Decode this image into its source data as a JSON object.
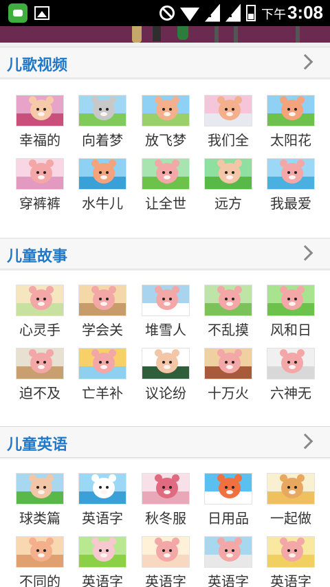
{
  "status_bar": {
    "time_prefix": "下午",
    "time": "3:08",
    "app_icon": "app-notification-icon",
    "picture_icon": "image-icon",
    "icons_right": [
      "blocked-icon",
      "wifi-icon",
      "signal-icon",
      "signal-icon",
      "battery-icon"
    ]
  },
  "colors": {
    "section_title": "#1f78c8",
    "banner": "#6b2a4f",
    "statusbar": "#000000"
  },
  "sections": [
    {
      "title": "儿歌视频",
      "items": [
        {
          "label": "幸福的",
          "thumb": "girl-stage"
        },
        {
          "label": "向着梦",
          "thumb": "animals-field"
        },
        {
          "label": "放飞梦",
          "thumb": "bear-sky"
        },
        {
          "label": "我们全",
          "thumb": "animal-group"
        },
        {
          "label": "太阳花",
          "thumb": "bears-green"
        },
        {
          "label": "穿裤裤",
          "thumb": "bear-pink-room"
        },
        {
          "label": "水牛儿",
          "thumb": "bears-water"
        },
        {
          "label": "让全世",
          "thumb": "bears-meadow"
        },
        {
          "label": "远方",
          "thumb": "girls-red"
        },
        {
          "label": "我最爱",
          "thumb": "swan-boat"
        }
      ]
    },
    {
      "title": "儿童故事",
      "items": [
        {
          "label": "心灵手",
          "thumb": "bear-flower"
        },
        {
          "label": "学会关",
          "thumb": "bears-room"
        },
        {
          "label": "堆雪人",
          "thumb": "snow-rabbit"
        },
        {
          "label": "不乱摸",
          "thumb": "bear-forest"
        },
        {
          "label": "风和日",
          "thumb": "bears-sunny"
        },
        {
          "label": "迫不及",
          "thumb": "bears-classroom"
        },
        {
          "label": "亡羊补",
          "thumb": "bear-rainbow"
        },
        {
          "label": "议论纷",
          "thumb": "blackboard"
        },
        {
          "label": "十万火",
          "thumb": "bear-library"
        },
        {
          "label": "六神无",
          "thumb": "bears-white"
        }
      ]
    },
    {
      "title": "儿童英语",
      "items": [
        {
          "label": "球类篇",
          "thumb": "boy-soccer"
        },
        {
          "label": "英语字",
          "thumb": "goose-lake"
        },
        {
          "label": "秋冬服",
          "thumb": "scarf"
        },
        {
          "label": "日用品",
          "thumb": "umbrella"
        },
        {
          "label": "一起做",
          "thumb": "flour-bag"
        },
        {
          "label": "不同的",
          "thumb": "girl-brown"
        },
        {
          "label": "英语字",
          "thumb": "rabbit-green"
        },
        {
          "label": "英语字",
          "thumb": "bears-pair"
        },
        {
          "label": "英语字",
          "thumb": "bears-blue"
        },
        {
          "label": "英语字",
          "thumb": "bears-yellow"
        }
      ]
    }
  ]
}
